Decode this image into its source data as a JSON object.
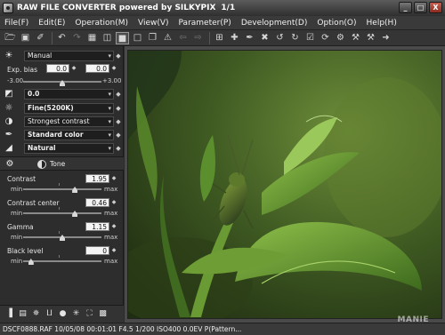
{
  "window": {
    "title": "RAW FILE CONVERTER powered by SILKYPIX",
    "page_counter": "1/1",
    "buttons": [
      "_",
      "□",
      "X"
    ]
  },
  "menu": [
    "File(F)",
    "Edit(E)",
    "Operation(M)",
    "View(V)",
    "Parameter(P)",
    "Development(D)",
    "Option(O)",
    "Help(H)"
  ],
  "toolbar_icons": [
    "open-folder-icon",
    "open-file-icon",
    "eraser-icon",
    "undo-icon",
    "redo-icon",
    "grid-view-icon",
    "split-view-icon",
    "single-view-icon",
    "full-view-icon",
    "crop-icon",
    "warning-icon",
    "back-icon",
    "forward-icon",
    "gridlines-icon",
    "eyedropper-plus-icon",
    "eyedropper-icon",
    "eyedropper-minus-icon",
    "rotate-left-icon",
    "rotate-right-icon",
    "checkbox-icon",
    "refresh-icon",
    "settings-icon",
    "develop-icon",
    "hammer-icon",
    "develop-arrow-icon"
  ],
  "panel": {
    "exposure_mode": "Manual",
    "exp_bias_label": "Exp. bias",
    "exp_bias_value": "0.0",
    "exp_bias_value2": "0.0",
    "exp_min": "-3.00",
    "exp_max": "+3.00",
    "exp_bias_fraction": 0.5,
    "brightness_value": "0.0",
    "white_balance": "Fine(5200K)",
    "tone_mode": "Strongest contrast",
    "color_mode": "Standard color",
    "style_mode": "Natural",
    "tab_label": "Tone",
    "min_label": "min",
    "max_label": "max",
    "sliders": [
      {
        "label": "Contrast",
        "value": "1.95",
        "fraction": 0.66
      },
      {
        "label": "Contrast center",
        "value": "0.46",
        "fraction": 0.66
      },
      {
        "label": "Gamma",
        "value": "1.15",
        "fraction": 0.5
      },
      {
        "label": "Black level",
        "value": "0",
        "fraction": 0.1
      }
    ]
  },
  "bottom_icons": [
    "histogram-icon",
    "raw-icon",
    "noise-icon",
    "curve-icon",
    "sphere-icon",
    "sharpen-icon",
    "fullscreen-icon",
    "layout-icon"
  ],
  "status": {
    "text": "DSCF0888.RAF 10/05/08 00:01:01 F4.5 1/200 ISO400  0.0EV P(Pattern..."
  },
  "watermark": "MANIE",
  "colors": {
    "accent": "#e8e8e8",
    "background": "#2b2b2b",
    "viewer_bg": "#4a4a4a"
  }
}
